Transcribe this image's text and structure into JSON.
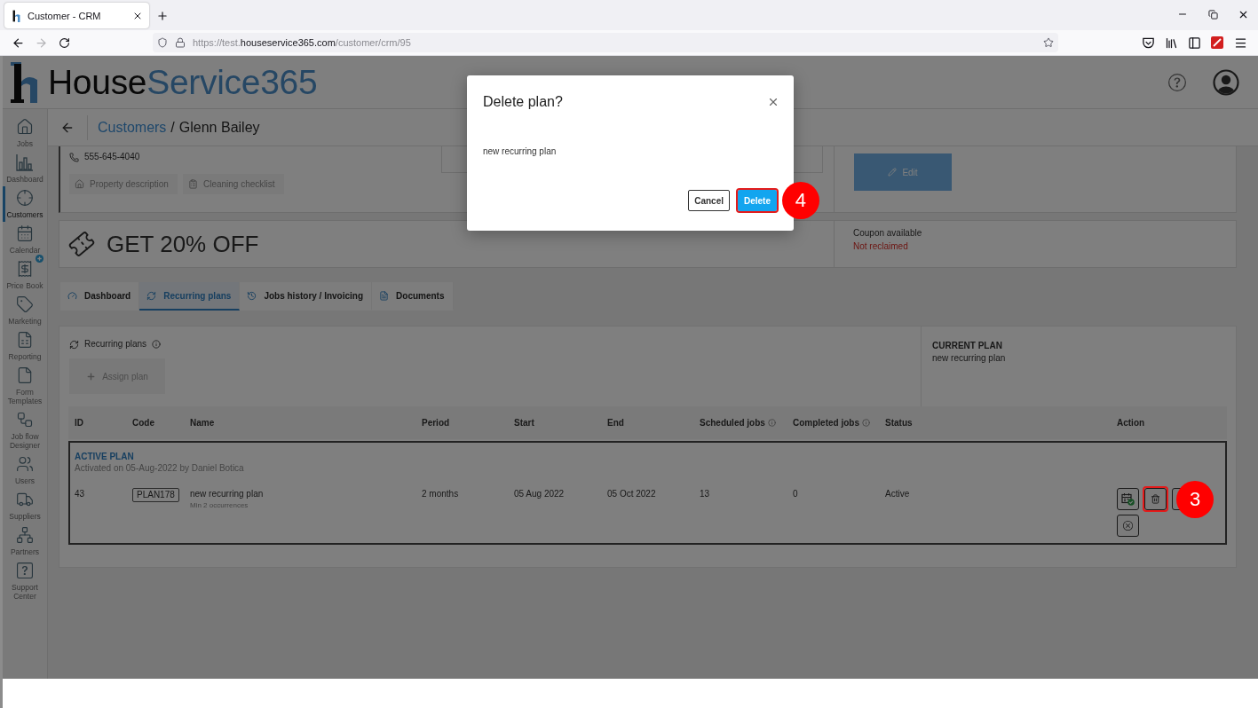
{
  "browser": {
    "tab_title": "Customer - CRM",
    "forward_disabled": true,
    "url": {
      "prefix": "https://test.",
      "domain": "houseservice365.com",
      "path": "/customer/crm/95"
    }
  },
  "header": {
    "logo_part_1": "House",
    "logo_part_2": "Service365"
  },
  "sidebar": {
    "items": [
      {
        "label": "Jobs",
        "selected": false
      },
      {
        "label": "Dashboard",
        "selected": false
      },
      {
        "label": "Customers",
        "selected": true
      },
      {
        "label": "Calendar",
        "selected": false
      },
      {
        "label": "Price Book",
        "selected": false
      },
      {
        "label": "Marketing",
        "selected": false
      },
      {
        "label": "Reporting",
        "selected": false
      },
      {
        "label": "Form Templates",
        "selected": false
      },
      {
        "label": "Job flow Designer",
        "selected": false
      },
      {
        "label": "Users",
        "selected": false
      },
      {
        "label": "Suppliers",
        "selected": false
      },
      {
        "label": "Partners",
        "selected": false
      },
      {
        "label": "Support Center",
        "selected": false
      }
    ]
  },
  "breadcrumb": {
    "link": "Customers",
    "separator": "/",
    "current": "Glenn Bailey"
  },
  "customer_card": {
    "phone": "555-645-4040",
    "buttons": [
      "Property description",
      "Cleaning checklist"
    ],
    "edit_button": "Edit"
  },
  "coupon": {
    "title": "GET 20% OFF",
    "label": "Coupon available",
    "status": "Not reclaimed"
  },
  "tabs": [
    {
      "label": "Dashboard",
      "selected": false
    },
    {
      "label": "Recurring plans",
      "selected": true
    },
    {
      "label": "Jobs history / Invoicing",
      "selected": false
    },
    {
      "label": "Documents",
      "selected": false
    }
  ],
  "recurring_plans": {
    "title": "Recurring plans",
    "assign_button": {
      "label": "Assign plan",
      "disabled": true
    },
    "current_plan": {
      "heading": "CURRENT PLAN",
      "name": "new recurring plan"
    }
  },
  "table": {
    "columns": [
      {
        "label": "ID",
        "info": false
      },
      {
        "label": "Code",
        "info": false
      },
      {
        "label": "Name",
        "info": false
      },
      {
        "label": "Period",
        "info": false
      },
      {
        "label": "Start",
        "info": false
      },
      {
        "label": "End",
        "info": false
      },
      {
        "label": "Scheduled jobs",
        "info": true
      },
      {
        "label": "Completed jobs",
        "info": true
      },
      {
        "label": "Status",
        "info": false
      },
      {
        "label": "Action",
        "info": false
      }
    ],
    "group": {
      "heading": "ACTIVE PLAN",
      "subtext": "Activated on 05-Aug-2022 by Daniel Botica"
    },
    "rows": [
      {
        "id": "43",
        "code": "PLAN178",
        "name": "new recurring plan",
        "note": "Min 2 occurrences",
        "period": "2 months",
        "start": "05 Aug 2022",
        "end": "05 Oct 2022",
        "scheduled_jobs": "13",
        "completed_jobs": "0",
        "status": "Active",
        "actions": [
          {
            "kind": "schedule",
            "highlighted": false
          },
          {
            "kind": "delete",
            "highlighted": true,
            "callout": "3"
          },
          {
            "kind": "covered",
            "highlighted": false
          },
          {
            "kind": "cancel",
            "highlighted": false
          }
        ]
      }
    ]
  },
  "modal": {
    "title": "Delete plan?",
    "message": "new recurring plan",
    "buttons": [
      {
        "label": "Cancel",
        "kind": "secondary",
        "highlighted": false
      },
      {
        "label": "Delete",
        "kind": "primary",
        "highlighted": true,
        "callout": "4"
      }
    ]
  }
}
